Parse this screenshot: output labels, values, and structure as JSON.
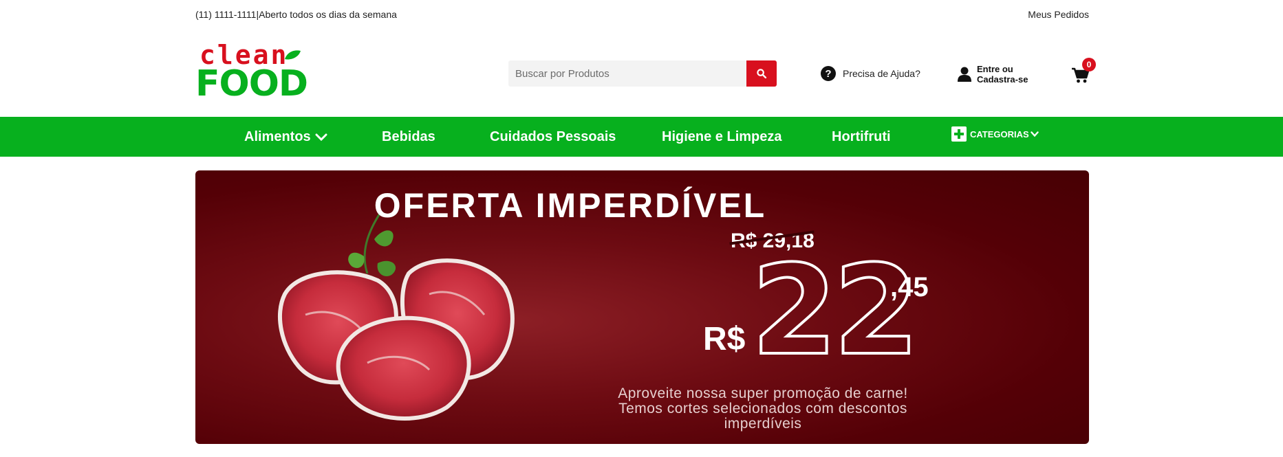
{
  "topbar": {
    "contact": "(11) 1111-1111|Aberto todos os dias da semana",
    "orders": "Meus Pedidos"
  },
  "logo": {
    "line1": "clean",
    "line2": "FOOD"
  },
  "search": {
    "placeholder": "Buscar por Produtos",
    "icon": "search-icon"
  },
  "help": {
    "label": "Precisa de Ajuda?",
    "icon": "question-circle-icon"
  },
  "account": {
    "line1": "Entre ou",
    "line2": "Cadastra-se",
    "icon": "user-icon"
  },
  "cart": {
    "count": "0",
    "icon": "cart-icon"
  },
  "nav": {
    "items": [
      {
        "label": "Alimentos",
        "has_dropdown": true
      },
      {
        "label": "Bebidas"
      },
      {
        "label": "Cuidados Pessoais"
      },
      {
        "label": "Higiene e Limpeza"
      },
      {
        "label": "Hortifruti"
      }
    ],
    "categories_label": "CATEGORIAS"
  },
  "banner": {
    "title": "OFERTA IMPERDÍVEL",
    "old_price": "R$ 29,18",
    "currency": "R$",
    "price_int": "22",
    "price_cents": ",45",
    "desc_line1": "Aproveite nossa super promoção de carne!",
    "desc_line2": "Temos cortes selecionados com descontos imperdíveis"
  },
  "colors": {
    "brand_green": "#07b01e",
    "brand_red": "#d8101e",
    "banner_red": "#5e0309"
  }
}
